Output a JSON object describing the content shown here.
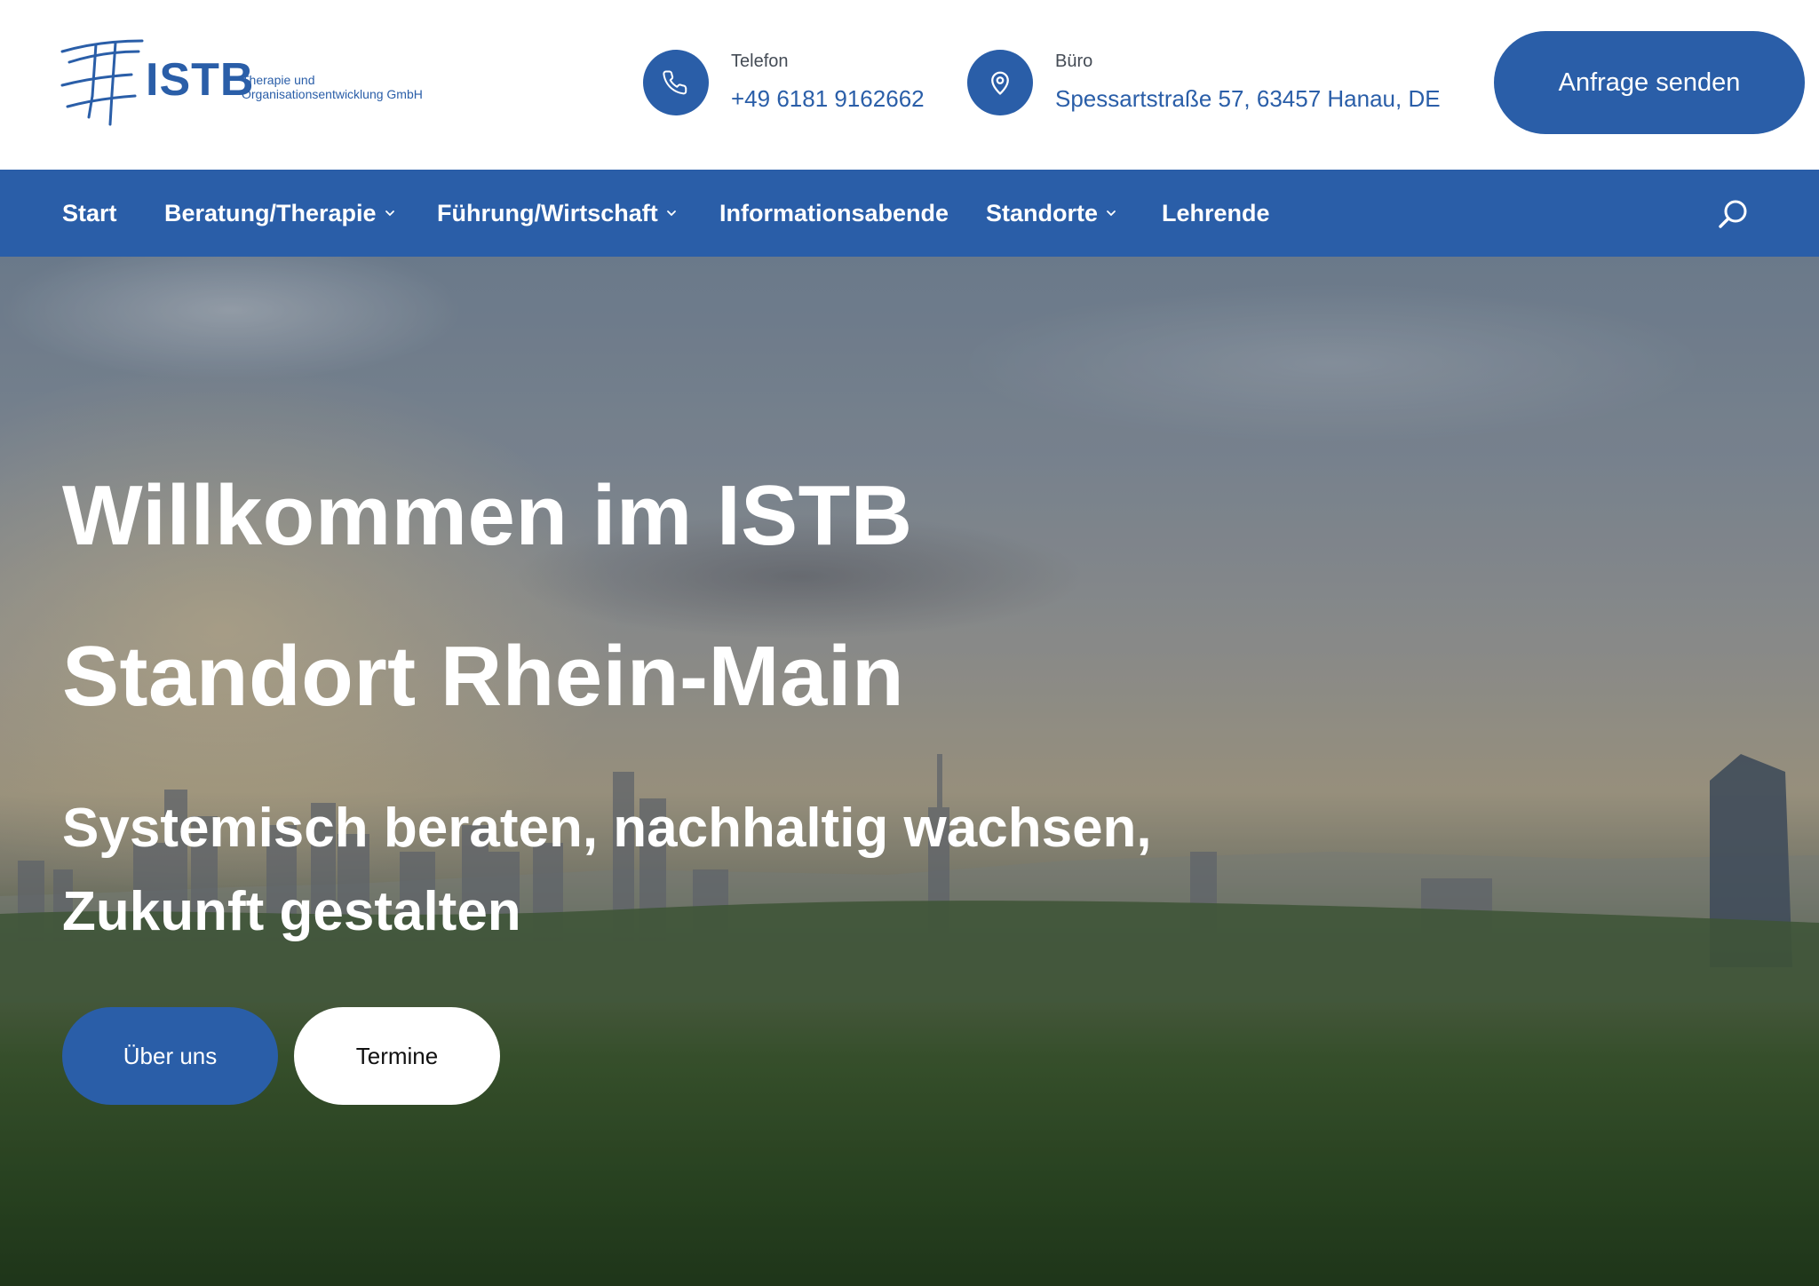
{
  "brand": {
    "name": "ISTB",
    "tagline_line1": "Therapie und",
    "tagline_line2": "Organisationsentwicklung GmbH",
    "color": "#2a5ea8"
  },
  "header": {
    "phone": {
      "label": "Telefon",
      "value": "+49 6181 9162662",
      "icon": "phone-icon"
    },
    "office": {
      "label": "Büro",
      "value": "Spessartstraße 57, 63457 Hanau, DE",
      "icon": "map-pin-icon"
    },
    "cta_label": "Anfrage senden"
  },
  "nav": {
    "items": [
      {
        "label": "Start",
        "has_dropdown": false
      },
      {
        "label": "Beratung/Therapie",
        "has_dropdown": true
      },
      {
        "label": "Führung/Wirtschaft",
        "has_dropdown": true
      },
      {
        "label": "Informationsabende",
        "has_dropdown": false
      },
      {
        "label": "Standorte",
        "has_dropdown": true
      },
      {
        "label": "Lehrende",
        "has_dropdown": false
      }
    ],
    "search_icon": "search-icon"
  },
  "hero": {
    "title_line1": "Willkommen im ISTB",
    "title_line2": "Standort Rhein-Main",
    "subtitle": "Systemisch beraten, nachhaltig wachsen, Zukunft gestalten",
    "primary_button": "Über uns",
    "secondary_button": "Termine"
  }
}
